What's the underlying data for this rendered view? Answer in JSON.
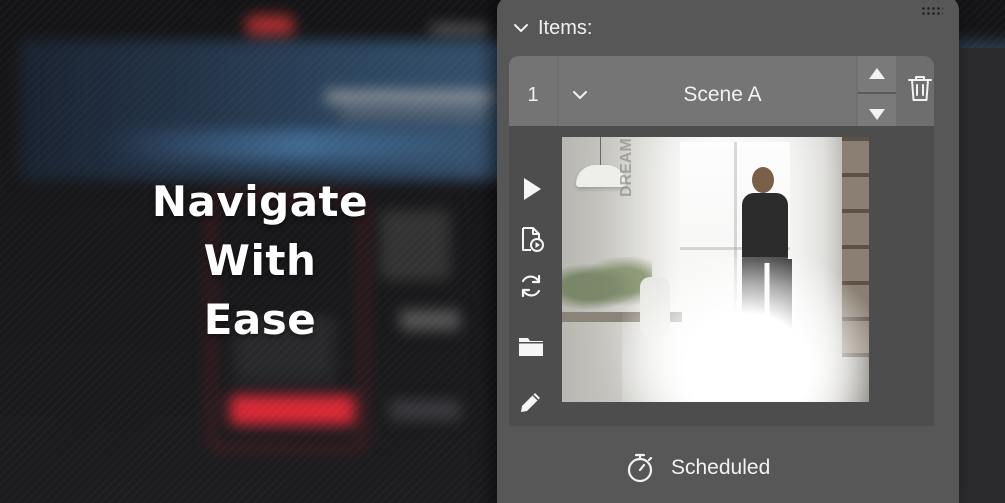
{
  "headline": {
    "lines": [
      "Navigate",
      "With",
      "Ease"
    ]
  },
  "panel": {
    "header_label": "Items:",
    "item": {
      "number": "1",
      "scene_name": "Scene A"
    },
    "thumbnail_text": "DREAM BIG.",
    "tools": [
      "play-icon",
      "file-play-icon",
      "refresh-icon",
      "folder-icon",
      "pencil-icon"
    ],
    "status_label": "Scheduled"
  },
  "colors": {
    "panel": "#575757",
    "text": "#f2f2f2",
    "background": "#1a1a1c"
  }
}
